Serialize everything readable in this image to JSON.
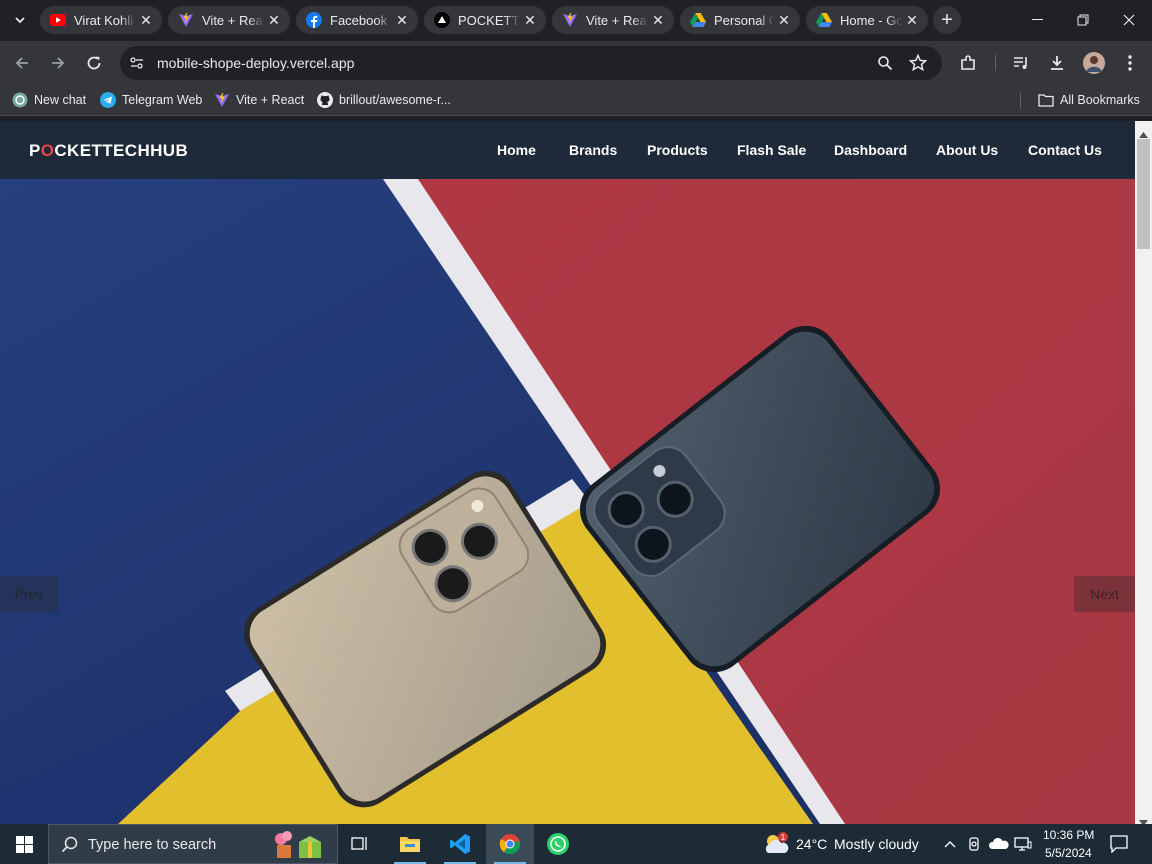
{
  "browser": {
    "tabs": [
      {
        "title": "Virat Kohli",
        "icon": "youtube-icon"
      },
      {
        "title": "Vite + React",
        "icon": "vite-icon"
      },
      {
        "title": "Facebook",
        "icon": "facebook-icon"
      },
      {
        "title": "POCKETTECHHUB",
        "icon": "vercel-icon",
        "active": true
      },
      {
        "title": "Vite + React",
        "icon": "vite-icon"
      },
      {
        "title": "Personal Cloud",
        "icon": "google-drive-icon"
      },
      {
        "title": "Home - Google Drive",
        "icon": "google-drive-icon"
      }
    ],
    "close_glyph": "✕",
    "new_tab_glyph": "+",
    "url": "mobile-shope-deploy.vercel.app",
    "bookmarks": [
      {
        "label": "New chat",
        "icon": "chatgpt-icon"
      },
      {
        "label": "Telegram Web",
        "icon": "telegram-icon"
      },
      {
        "label": "Vite + React",
        "icon": "vite-icon"
      },
      {
        "label": "brillout/awesome-r...",
        "icon": "github-icon"
      }
    ],
    "all_bookmarks": "All Bookmarks"
  },
  "site": {
    "logo_first": "P",
    "logo_accent": "O",
    "logo_rest": "CKETTECHHUB",
    "nav": [
      "Home",
      "Brands",
      "Products",
      "Flash Sale",
      "Dashboard",
      "About Us",
      "Contact Us"
    ],
    "slider": {
      "prev": "Prev",
      "next": "Next"
    }
  },
  "taskbar": {
    "search_placeholder": "Type here to search",
    "weather_temp": "24°C",
    "weather_desc": "Mostly cloudy",
    "weather_badge": "1",
    "time": "10:36 PM",
    "date": "5/5/2024"
  },
  "colors": {
    "navbar_bg": "#1e2939",
    "logo_accent": "#ef4444",
    "hero_blue": "#23448c",
    "hero_red": "#b23d48",
    "hero_yellow": "#e4c128"
  }
}
